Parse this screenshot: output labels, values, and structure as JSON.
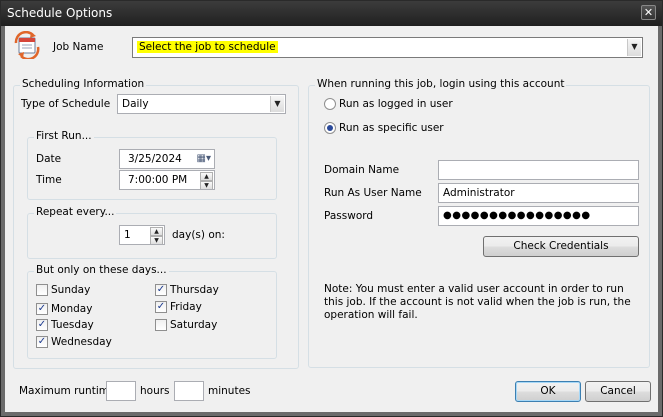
{
  "window": {
    "title": "Schedule Options",
    "close_glyph": "✕"
  },
  "job": {
    "label": "Job Name",
    "value": "Select the job to schedule",
    "highlight_color": "#ffff00"
  },
  "scheduling": {
    "title": "Scheduling Information",
    "type_label": "Type of Schedule",
    "type_value": "Daily",
    "first_run": {
      "title": "First Run...",
      "date_label": "Date",
      "date_value": "3/25/2024",
      "time_label": "Time",
      "time_value": "7:00:00 PM"
    },
    "repeat": {
      "title": "Repeat every...",
      "value": "1",
      "suffix": "day(s) on:"
    },
    "days": {
      "title": "But only on these days...",
      "items": [
        {
          "label": "Sunday",
          "checked": false
        },
        {
          "label": "Monday",
          "checked": true
        },
        {
          "label": "Tuesday",
          "checked": true
        },
        {
          "label": "Wednesday",
          "checked": true
        },
        {
          "label": "Thursday",
          "checked": true
        },
        {
          "label": "Friday",
          "checked": true
        },
        {
          "label": "Saturday",
          "checked": false
        }
      ]
    }
  },
  "login": {
    "title": "When running this job, login using this account",
    "option_logged_in": "Run as logged in user",
    "option_specific": "Run as specific user",
    "selected": "specific",
    "domain_label": "Domain Name",
    "domain_value": "",
    "user_label": "Run As User Name",
    "user_value": "Administrator",
    "password_label": "Password",
    "password_value": "●●●●●●●●●●●●●●●●",
    "check_button": "Check Credentials",
    "note": "Note: You must enter a valid user account in order to run this job. If the account is not valid when the job is run, the operation will fail."
  },
  "runtime": {
    "label": "Maximum runtime:",
    "hours_value": "",
    "hours_label": "hours",
    "minutes_value": "",
    "minutes_label": "minutes"
  },
  "buttons": {
    "ok": "OK",
    "cancel": "Cancel"
  }
}
